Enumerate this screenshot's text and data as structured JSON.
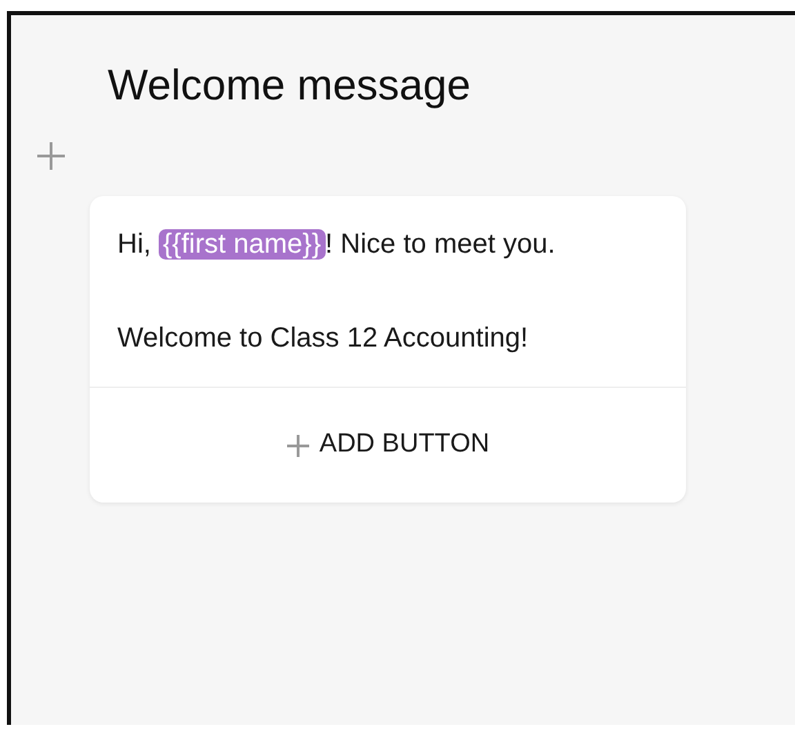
{
  "title": "Welcome message",
  "message": {
    "paragraphs": [
      {
        "parts": [
          {
            "kind": "text",
            "text": "Hi, "
          },
          {
            "kind": "variable",
            "text": "{{first name}}"
          },
          {
            "kind": "text",
            "text": "! Nice to meet you."
          }
        ]
      },
      {
        "parts": [
          {
            "kind": "text",
            "text": "Welcome to Class 12 Accounting!"
          }
        ]
      }
    ]
  },
  "add_button": {
    "label": "ADD BUTTON"
  }
}
